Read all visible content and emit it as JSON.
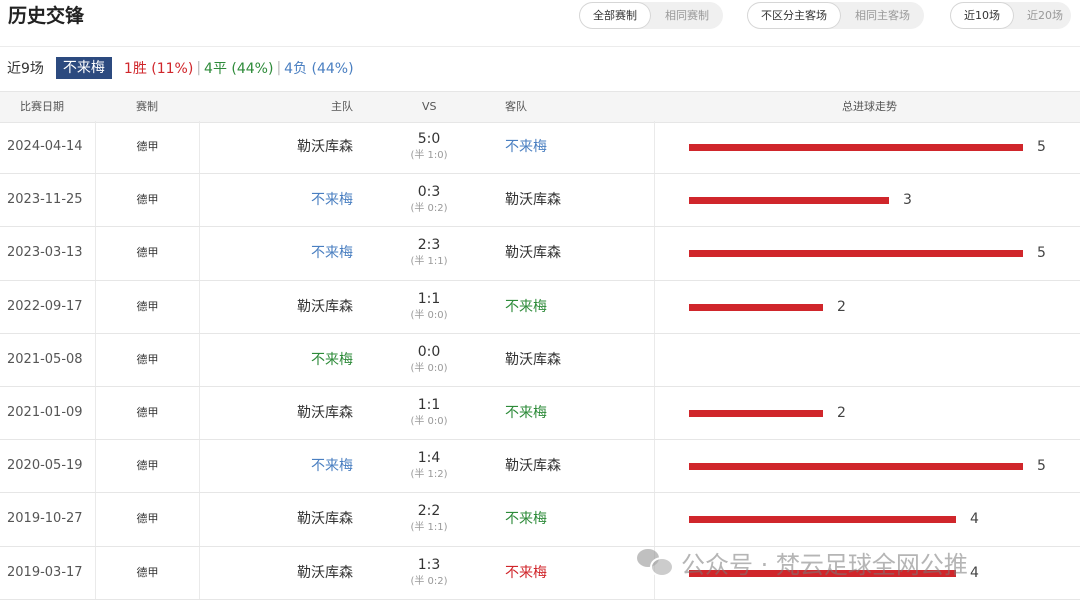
{
  "header": {
    "title": "历史交锋",
    "filters": [
      {
        "options": [
          "全部赛制",
          "相同赛制"
        ],
        "active": 0
      },
      {
        "options": [
          "不区分主客场",
          "相同主客场"
        ],
        "active": 0
      },
      {
        "options": [
          "近10场",
          "近20场"
        ],
        "active": 0
      }
    ]
  },
  "summary": {
    "count": "近9场",
    "team": "不来梅",
    "win": "1胜 (11%)",
    "draw": "4平 (44%)",
    "loss": "4负 (44%)",
    "separator": "|"
  },
  "columns": {
    "date": "比赛日期",
    "league": "赛制",
    "home": "主队",
    "vs": "VS",
    "away": "客队",
    "trend": "总进球走势"
  },
  "colors": {
    "bar": "#d0262b",
    "win": "#d0262b",
    "draw": "#2e8b3a",
    "loss": "#4a7fc1",
    "badge": "#2c4a7f"
  },
  "max_goals": 5,
  "matches": [
    {
      "date": "2024-04-14",
      "league": "德甲",
      "home": "勒沃库森",
      "home_color": "dark",
      "score": "5:0",
      "half": "(半 1:0)",
      "away": "不来梅",
      "away_color": "blue",
      "total": 5
    },
    {
      "date": "2023-11-25",
      "league": "德甲",
      "home": "不来梅",
      "home_color": "blue",
      "score": "0:3",
      "half": "(半 0:2)",
      "away": "勒沃库森",
      "away_color": "dark",
      "total": 3
    },
    {
      "date": "2023-03-13",
      "league": "德甲",
      "home": "不来梅",
      "home_color": "blue",
      "score": "2:3",
      "half": "(半 1:1)",
      "away": "勒沃库森",
      "away_color": "dark",
      "total": 5
    },
    {
      "date": "2022-09-17",
      "league": "德甲",
      "home": "勒沃库森",
      "home_color": "dark",
      "score": "1:1",
      "half": "(半 0:0)",
      "away": "不来梅",
      "away_color": "green",
      "total": 2
    },
    {
      "date": "2021-05-08",
      "league": "德甲",
      "home": "不来梅",
      "home_color": "green",
      "score": "0:0",
      "half": "(半 0:0)",
      "away": "勒沃库森",
      "away_color": "dark",
      "total": 0
    },
    {
      "date": "2021-01-09",
      "league": "德甲",
      "home": "勒沃库森",
      "home_color": "dark",
      "score": "1:1",
      "half": "(半 0:0)",
      "away": "不来梅",
      "away_color": "green",
      "total": 2
    },
    {
      "date": "2020-05-19",
      "league": "德甲",
      "home": "不来梅",
      "home_color": "blue",
      "score": "1:4",
      "half": "(半 1:2)",
      "away": "勒沃库森",
      "away_color": "dark",
      "total": 5
    },
    {
      "date": "2019-10-27",
      "league": "德甲",
      "home": "勒沃库森",
      "home_color": "dark",
      "score": "2:2",
      "half": "(半 1:1)",
      "away": "不来梅",
      "away_color": "green",
      "total": 4
    },
    {
      "date": "2019-03-17",
      "league": "德甲",
      "home": "勒沃库森",
      "home_color": "dark",
      "score": "1:3",
      "half": "(半 0:2)",
      "away": "不来梅",
      "away_color": "red",
      "total": 4
    }
  ],
  "watermark": {
    "text": "公众号 · 梵云足球全网公推",
    "icon": "wechat-icon"
  }
}
